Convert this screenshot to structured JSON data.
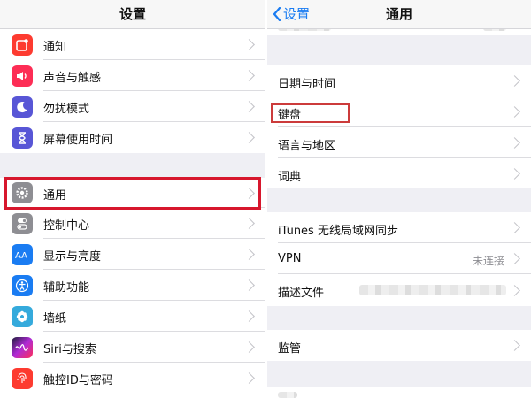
{
  "left": {
    "title": "设置",
    "items": [
      {
        "label": "通知",
        "icon": "notifications-icon",
        "color": "#fd3b30"
      },
      {
        "label": "声音与触感",
        "icon": "speaker-icon",
        "color": "#fd2d55"
      },
      {
        "label": "勿扰模式",
        "icon": "moon-icon",
        "color": "#5856d6"
      },
      {
        "label": "屏幕使用时间",
        "icon": "hourglass-icon",
        "color": "#5856d6"
      },
      {
        "label": "通用",
        "icon": "gear-icon",
        "color": "#8e8e93"
      },
      {
        "label": "控制中心",
        "icon": "toggles-icon",
        "color": "#8e8e93"
      },
      {
        "label": "显示与亮度",
        "icon": "text-size-icon",
        "color": "#1a7cf2"
      },
      {
        "label": "辅助功能",
        "icon": "accessibility-icon",
        "color": "#1a7cf2"
      },
      {
        "label": "墙纸",
        "icon": "flower-icon",
        "color": "#35aadc"
      },
      {
        "label": "Siri与搜索",
        "icon": "siri-icon",
        "color": "#222222"
      },
      {
        "label": "触控ID与密码",
        "icon": "fingerprint-icon",
        "color": "#fd3b30"
      }
    ]
  },
  "right": {
    "back_label": "设置",
    "title": "通用",
    "items": [
      {
        "label": "日期与时间"
      },
      {
        "label": "键盘"
      },
      {
        "label": "语言与地区"
      },
      {
        "label": "词典"
      },
      {
        "label": "iTunes 无线局域网同步"
      },
      {
        "label": "VPN",
        "value": "未连接"
      },
      {
        "label": "描述文件"
      },
      {
        "label": "监管"
      }
    ]
  },
  "colors": {
    "highlight": "#d7172d",
    "link": "#1a7cf2",
    "background": "#efeff4"
  }
}
